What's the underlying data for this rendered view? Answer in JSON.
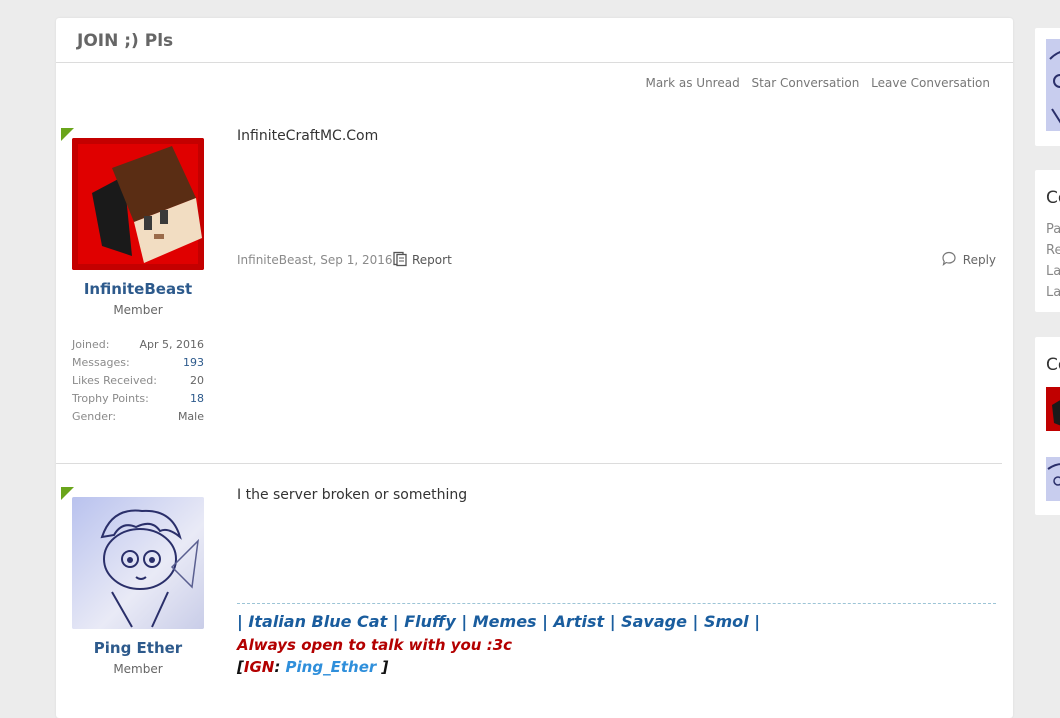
{
  "conversation": {
    "title": "JOIN ;) Pls",
    "actions": {
      "mark_unread": "Mark as Unread",
      "star": "Star Conversation",
      "leave": "Leave Conversation"
    }
  },
  "posts": [
    {
      "username": "InfiniteBeast",
      "user_title": "Member",
      "stats": [
        {
          "label": "Joined:",
          "value": "Apr 5, 2016"
        },
        {
          "label": "Messages:",
          "value": "193"
        },
        {
          "label": "Likes Received:",
          "value": "20"
        },
        {
          "label": "Trophy Points:",
          "value": "18"
        },
        {
          "label": "Gender:",
          "value": "Male"
        }
      ],
      "message": "InfiniteCraftMC.Com",
      "meta": "InfiniteBeast, Sep 1, 2016",
      "report_label": "Report",
      "reply_label": "Reply"
    },
    {
      "username": "Ping Ether",
      "user_title": "Member",
      "message": "I the server broken or something",
      "signature": {
        "line1": "| Italian Blue Cat | Fluffy | Memes | Artist | Savage | Smol |",
        "line2": "Always open to talk with you :3c",
        "line3_open": "[",
        "line3_label": "IGN",
        "line3_colon": ": ",
        "line3_value": "Ping_Ether",
        "line3_close": " ]"
      }
    }
  ],
  "sidebar": {
    "block2_heading": "Co",
    "block2_lines": [
      "Pa",
      "Re",
      "La",
      "La"
    ],
    "block3_heading": "Co"
  },
  "colors": {
    "accent_green": "#6aa51b",
    "username_blue": "#2d5a8c"
  }
}
